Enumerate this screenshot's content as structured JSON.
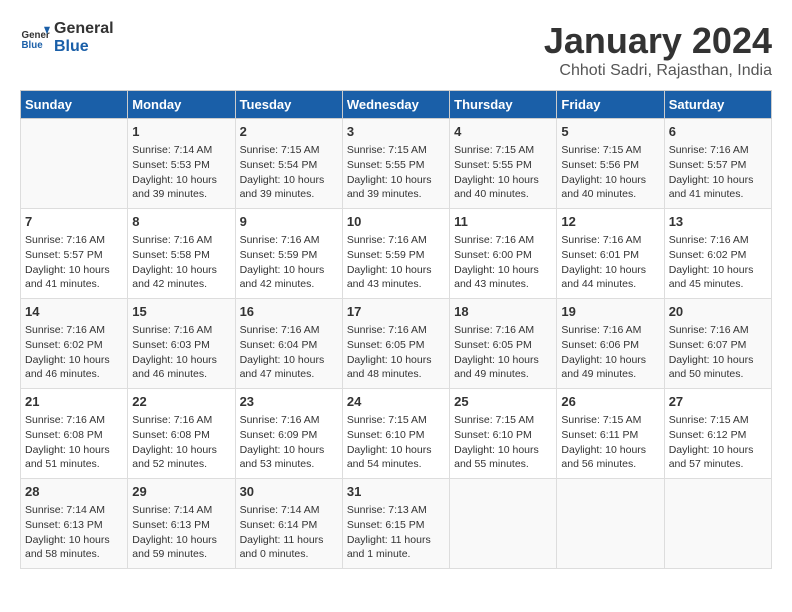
{
  "header": {
    "logo_general": "General",
    "logo_blue": "Blue",
    "month_title": "January 2024",
    "subtitle": "Chhoti Sadri, Rajasthan, India"
  },
  "days_of_week": [
    "Sunday",
    "Monday",
    "Tuesday",
    "Wednesday",
    "Thursday",
    "Friday",
    "Saturday"
  ],
  "weeks": [
    [
      {
        "day": "",
        "info": ""
      },
      {
        "day": "1",
        "info": "Sunrise: 7:14 AM\nSunset: 5:53 PM\nDaylight: 10 hours\nand 39 minutes."
      },
      {
        "day": "2",
        "info": "Sunrise: 7:15 AM\nSunset: 5:54 PM\nDaylight: 10 hours\nand 39 minutes."
      },
      {
        "day": "3",
        "info": "Sunrise: 7:15 AM\nSunset: 5:55 PM\nDaylight: 10 hours\nand 39 minutes."
      },
      {
        "day": "4",
        "info": "Sunrise: 7:15 AM\nSunset: 5:55 PM\nDaylight: 10 hours\nand 40 minutes."
      },
      {
        "day": "5",
        "info": "Sunrise: 7:15 AM\nSunset: 5:56 PM\nDaylight: 10 hours\nand 40 minutes."
      },
      {
        "day": "6",
        "info": "Sunrise: 7:16 AM\nSunset: 5:57 PM\nDaylight: 10 hours\nand 41 minutes."
      }
    ],
    [
      {
        "day": "7",
        "info": "Sunrise: 7:16 AM\nSunset: 5:57 PM\nDaylight: 10 hours\nand 41 minutes."
      },
      {
        "day": "8",
        "info": "Sunrise: 7:16 AM\nSunset: 5:58 PM\nDaylight: 10 hours\nand 42 minutes."
      },
      {
        "day": "9",
        "info": "Sunrise: 7:16 AM\nSunset: 5:59 PM\nDaylight: 10 hours\nand 42 minutes."
      },
      {
        "day": "10",
        "info": "Sunrise: 7:16 AM\nSunset: 5:59 PM\nDaylight: 10 hours\nand 43 minutes."
      },
      {
        "day": "11",
        "info": "Sunrise: 7:16 AM\nSunset: 6:00 PM\nDaylight: 10 hours\nand 43 minutes."
      },
      {
        "day": "12",
        "info": "Sunrise: 7:16 AM\nSunset: 6:01 PM\nDaylight: 10 hours\nand 44 minutes."
      },
      {
        "day": "13",
        "info": "Sunrise: 7:16 AM\nSunset: 6:02 PM\nDaylight: 10 hours\nand 45 minutes."
      }
    ],
    [
      {
        "day": "14",
        "info": "Sunrise: 7:16 AM\nSunset: 6:02 PM\nDaylight: 10 hours\nand 46 minutes."
      },
      {
        "day": "15",
        "info": "Sunrise: 7:16 AM\nSunset: 6:03 PM\nDaylight: 10 hours\nand 46 minutes."
      },
      {
        "day": "16",
        "info": "Sunrise: 7:16 AM\nSunset: 6:04 PM\nDaylight: 10 hours\nand 47 minutes."
      },
      {
        "day": "17",
        "info": "Sunrise: 7:16 AM\nSunset: 6:05 PM\nDaylight: 10 hours\nand 48 minutes."
      },
      {
        "day": "18",
        "info": "Sunrise: 7:16 AM\nSunset: 6:05 PM\nDaylight: 10 hours\nand 49 minutes."
      },
      {
        "day": "19",
        "info": "Sunrise: 7:16 AM\nSunset: 6:06 PM\nDaylight: 10 hours\nand 49 minutes."
      },
      {
        "day": "20",
        "info": "Sunrise: 7:16 AM\nSunset: 6:07 PM\nDaylight: 10 hours\nand 50 minutes."
      }
    ],
    [
      {
        "day": "21",
        "info": "Sunrise: 7:16 AM\nSunset: 6:08 PM\nDaylight: 10 hours\nand 51 minutes."
      },
      {
        "day": "22",
        "info": "Sunrise: 7:16 AM\nSunset: 6:08 PM\nDaylight: 10 hours\nand 52 minutes."
      },
      {
        "day": "23",
        "info": "Sunrise: 7:16 AM\nSunset: 6:09 PM\nDaylight: 10 hours\nand 53 minutes."
      },
      {
        "day": "24",
        "info": "Sunrise: 7:15 AM\nSunset: 6:10 PM\nDaylight: 10 hours\nand 54 minutes."
      },
      {
        "day": "25",
        "info": "Sunrise: 7:15 AM\nSunset: 6:10 PM\nDaylight: 10 hours\nand 55 minutes."
      },
      {
        "day": "26",
        "info": "Sunrise: 7:15 AM\nSunset: 6:11 PM\nDaylight: 10 hours\nand 56 minutes."
      },
      {
        "day": "27",
        "info": "Sunrise: 7:15 AM\nSunset: 6:12 PM\nDaylight: 10 hours\nand 57 minutes."
      }
    ],
    [
      {
        "day": "28",
        "info": "Sunrise: 7:14 AM\nSunset: 6:13 PM\nDaylight: 10 hours\nand 58 minutes."
      },
      {
        "day": "29",
        "info": "Sunrise: 7:14 AM\nSunset: 6:13 PM\nDaylight: 10 hours\nand 59 minutes."
      },
      {
        "day": "30",
        "info": "Sunrise: 7:14 AM\nSunset: 6:14 PM\nDaylight: 11 hours\nand 0 minutes."
      },
      {
        "day": "31",
        "info": "Sunrise: 7:13 AM\nSunset: 6:15 PM\nDaylight: 11 hours\nand 1 minute."
      },
      {
        "day": "",
        "info": ""
      },
      {
        "day": "",
        "info": ""
      },
      {
        "day": "",
        "info": ""
      }
    ]
  ]
}
